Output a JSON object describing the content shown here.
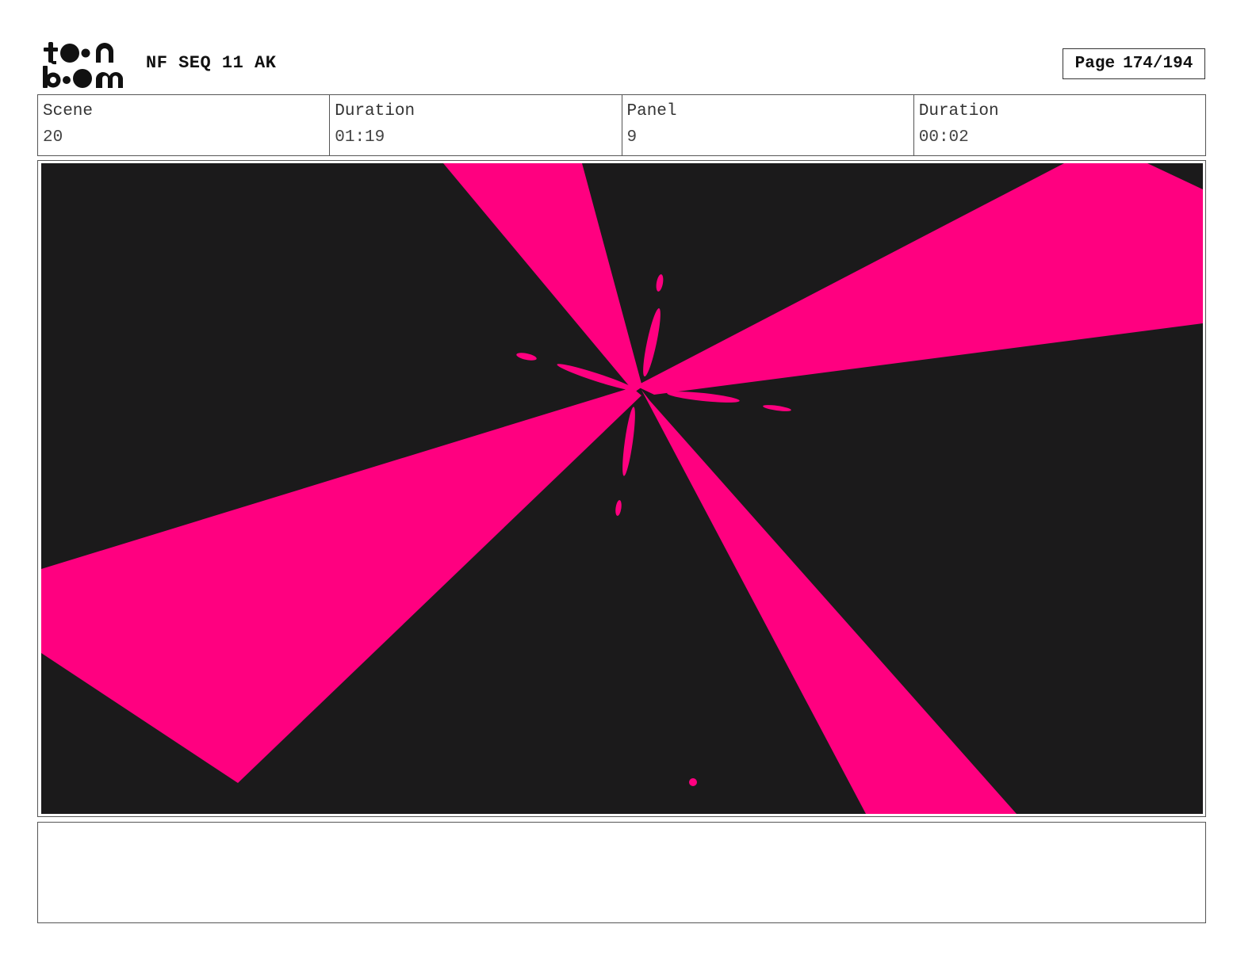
{
  "header": {
    "logo_icon": "toon-boom-logo",
    "title": "NF SEQ 11 AK",
    "page_label": "Page",
    "page_value": "174/194"
  },
  "info": {
    "scene_label": "Scene",
    "scene_value": "20",
    "scene_duration_label": "Duration",
    "scene_duration_value": "01:19",
    "panel_label": "Panel",
    "panel_value": "9",
    "panel_duration_label": "Duration",
    "panel_duration_value": "00:02"
  },
  "panel": {
    "background_color": "#1b1a1b",
    "accent_color": "#ff0080"
  },
  "notes": {}
}
